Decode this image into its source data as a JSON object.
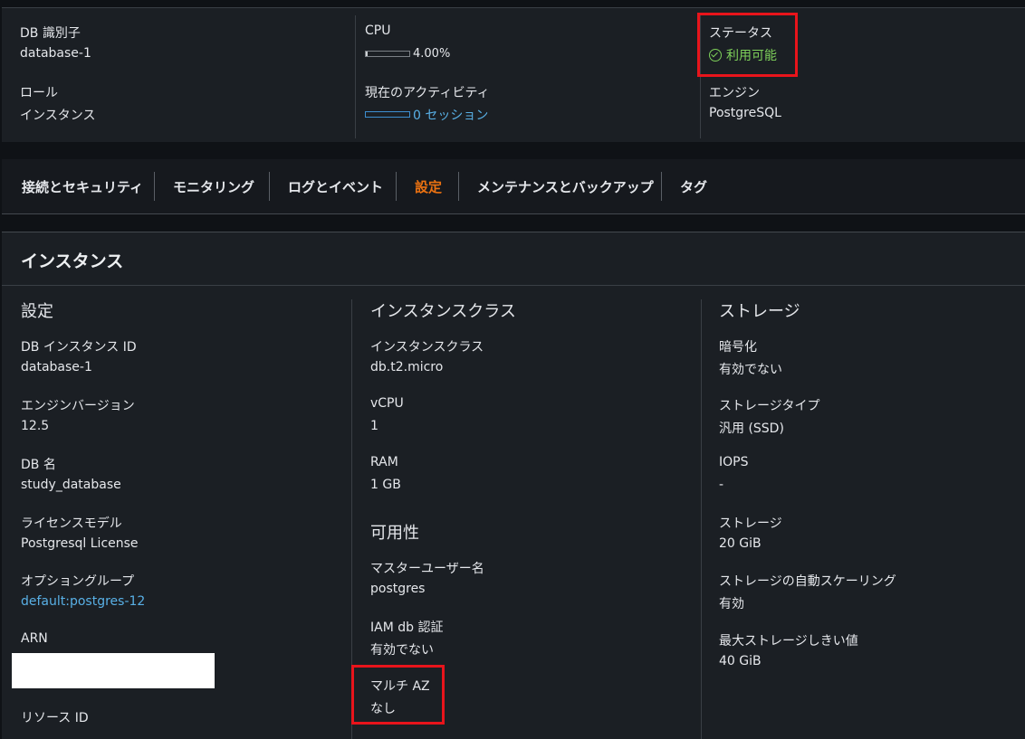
{
  "summary": {
    "db_id": {
      "label": "DB 識別子",
      "value": "database-1"
    },
    "role": {
      "label": "ロール",
      "value": "インスタンス"
    },
    "cpu": {
      "label": "CPU",
      "value": "4.00%",
      "percent": 4
    },
    "activity": {
      "label": "現在のアクティビティ",
      "value": "0 セッション"
    },
    "status": {
      "label": "ステータス",
      "value": "利用可能",
      "icon": "check-circle-icon",
      "color": "#7ed05a"
    },
    "engine": {
      "label": "エンジン",
      "value": "PostgreSQL"
    }
  },
  "tabs": [
    {
      "label": "接続とセキュリティ"
    },
    {
      "label": "モニタリング"
    },
    {
      "label": "ログとイベント"
    },
    {
      "label": "設定",
      "active": true
    },
    {
      "label": "メンテナンスとバックアップ"
    },
    {
      "label": "タグ"
    }
  ],
  "panel": {
    "title": "インスタンス",
    "config": {
      "title": "設定",
      "instance_id": {
        "label": "DB インスタンス ID",
        "value": "database-1"
      },
      "engine_version": {
        "label": "エンジンバージョン",
        "value": "12.5"
      },
      "db_name": {
        "label": "DB 名",
        "value": "study_database"
      },
      "license": {
        "label": "ライセンスモデル",
        "value": "Postgresql License"
      },
      "option_group": {
        "label": "オプショングループ",
        "value": "default:postgres-12"
      },
      "arn": {
        "label": "ARN"
      },
      "resource_id": {
        "label": "リソース ID"
      }
    },
    "instance_class": {
      "title": "インスタンスクラス",
      "class": {
        "label": "インスタンスクラス",
        "value": "db.t2.micro"
      },
      "vcpu": {
        "label": "vCPU",
        "value": "1"
      },
      "ram": {
        "label": "RAM",
        "value": "1 GB"
      }
    },
    "availability": {
      "title": "可用性",
      "master_user": {
        "label": "マスターユーザー名",
        "value": "postgres"
      },
      "iam_auth": {
        "label": "IAM db 認証",
        "value": "有効でない"
      },
      "multi_az": {
        "label": "マルチ AZ",
        "value": "なし"
      }
    },
    "storage": {
      "title": "ストレージ",
      "encryption": {
        "label": "暗号化",
        "value": "有効でない"
      },
      "type": {
        "label": "ストレージタイプ",
        "value": "汎用 (SSD)"
      },
      "iops": {
        "label": "IOPS",
        "value": "-"
      },
      "size": {
        "label": "ストレージ",
        "value": "20 GiB"
      },
      "autoscaling": {
        "label": "ストレージの自動スケーリング",
        "value": "有効"
      },
      "max_threshold": {
        "label": "最大ストレージしきい値",
        "value": "40 GiB"
      }
    }
  },
  "colors": {
    "accent": "#ec7211",
    "link": "#59b0e6",
    "highlight_box": "#e8141b"
  }
}
